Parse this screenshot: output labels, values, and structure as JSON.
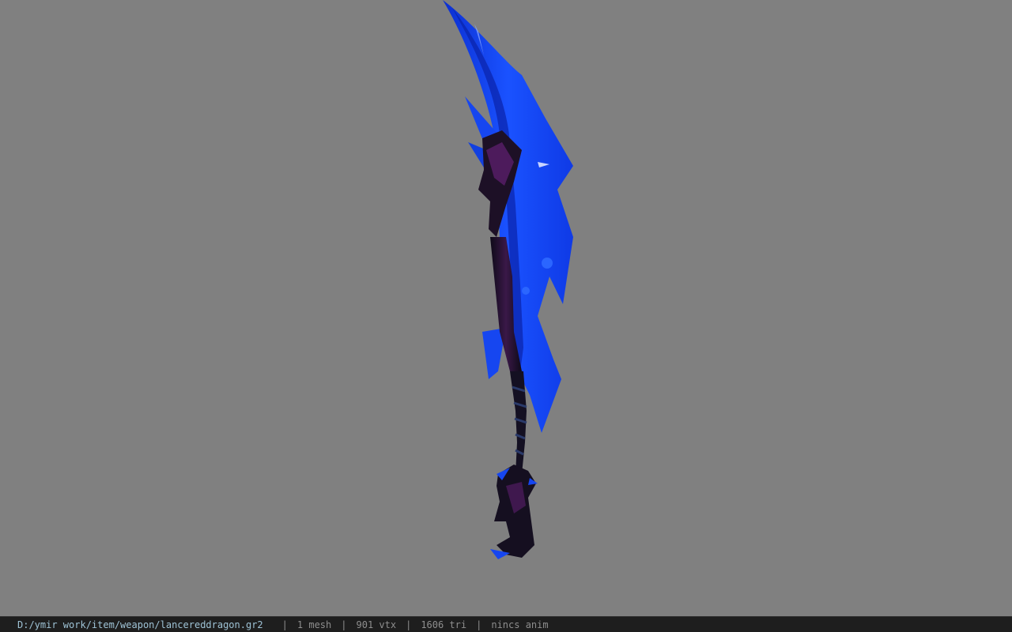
{
  "viewer": {
    "background_color": "#808080",
    "model_primary_color": "#1646f0",
    "model_dark_color": "#1a0f22",
    "model_accent_color": "#5a1e6a"
  },
  "status": {
    "file_path": "D:/ymir work/item/weapon/lancereddragon.gr2",
    "separator": "|",
    "mesh_count": "1 mesh",
    "vertex_count": "901 vtx",
    "triangle_count": "1606 tri",
    "animation": "nincs anim"
  }
}
